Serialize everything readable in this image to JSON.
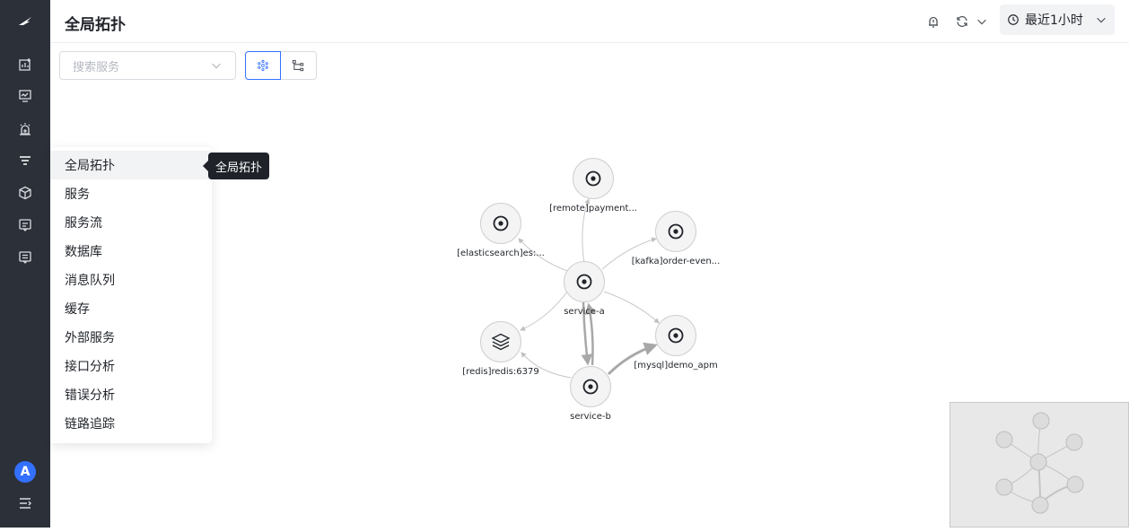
{
  "app": {
    "logo": "bird-logo-icon"
  },
  "sidebar": {
    "icons": [
      "chart-add-icon",
      "monitor-icon",
      "alarm-icon",
      "filter-list-icon",
      "cube-icon",
      "message-icon",
      "message-alt-icon"
    ],
    "avatar_letter": "A",
    "collapse_icon": "expand-menu-icon"
  },
  "header": {
    "title": "全局拓扑",
    "time_range": "最近1小时"
  },
  "toolbar": {
    "search_placeholder": "搜索服务"
  },
  "menu": {
    "items": [
      {
        "label": "全局拓扑",
        "active": true
      },
      {
        "label": "服务"
      },
      {
        "label": "服务流"
      },
      {
        "label": "数据库"
      },
      {
        "label": "消息队列"
      },
      {
        "label": "缓存"
      },
      {
        "label": "外部服务"
      },
      {
        "label": "接口分析"
      },
      {
        "label": "错误分析"
      },
      {
        "label": "链路追踪"
      }
    ],
    "tooltip": "全局拓扑"
  },
  "topology": {
    "nodes": [
      {
        "id": "remote",
        "label": "[remote]payment...",
        "icon": "target-icon"
      },
      {
        "id": "es",
        "label": "[elasticsearch]es:...",
        "icon": "target-icon"
      },
      {
        "id": "kafka",
        "label": "[kafka]order-even...",
        "icon": "target-icon"
      },
      {
        "id": "svca",
        "label": "service-a",
        "icon": "target-icon"
      },
      {
        "id": "redis",
        "label": "[redis]redis:6379",
        "icon": "layers-icon"
      },
      {
        "id": "mysql",
        "label": "[mysql]demo_apm",
        "icon": "target-icon"
      },
      {
        "id": "svcb",
        "label": "service-b",
        "icon": "target-icon"
      }
    ],
    "edges": [
      [
        "svca",
        "remote"
      ],
      [
        "svca",
        "es"
      ],
      [
        "svca",
        "kafka"
      ],
      [
        "svca",
        "redis"
      ],
      [
        "svca",
        "mysql"
      ],
      [
        "svca",
        "svcb"
      ],
      [
        "svcb",
        "svca"
      ],
      [
        "svcb",
        "redis"
      ],
      [
        "svcb",
        "mysql"
      ]
    ]
  }
}
